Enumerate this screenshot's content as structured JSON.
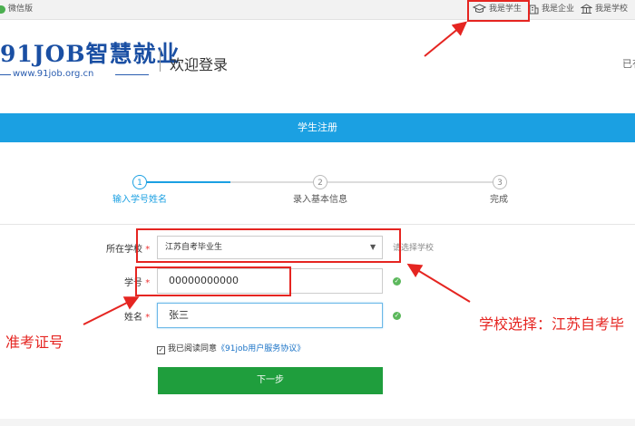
{
  "topbar": {
    "wechat_label": "微信版",
    "student_label": "我是学生",
    "company_label": "我是企业",
    "school_label": "我是学校"
  },
  "header": {
    "logo_text": "91JOB智慧就业",
    "logo_url": "www.91job.org.cn",
    "title": "欢迎登录",
    "right_text": "已有"
  },
  "page_bar": {
    "title": "学生注册"
  },
  "steps": [
    {
      "number": "1",
      "label": "输入学号姓名",
      "active": true
    },
    {
      "number": "2",
      "label": "录入基本信息",
      "active": false
    },
    {
      "number": "3",
      "label": "完成",
      "active": false
    }
  ],
  "form": {
    "school": {
      "label": "所在学校",
      "required": "*",
      "selected": "江苏自考毕业生",
      "hint": "请选择学校"
    },
    "student_id": {
      "label": "学号",
      "required": "*",
      "value": "00000000000"
    },
    "name": {
      "label": "姓名",
      "required": "*",
      "value": "张三"
    },
    "agreement": {
      "prefix": "我已阅读同意",
      "link": "《91job用户服务协议》"
    },
    "next_button": "下一步"
  },
  "annotations": {
    "exam_id": "准考证号",
    "school_choice": "学校选择：江苏自考毕"
  },
  "colors": {
    "primary_blue": "#1ba0e2",
    "button_green": "#1f9e3d",
    "annotation_red": "#e52521",
    "logo_blue": "#1a4fa3"
  }
}
